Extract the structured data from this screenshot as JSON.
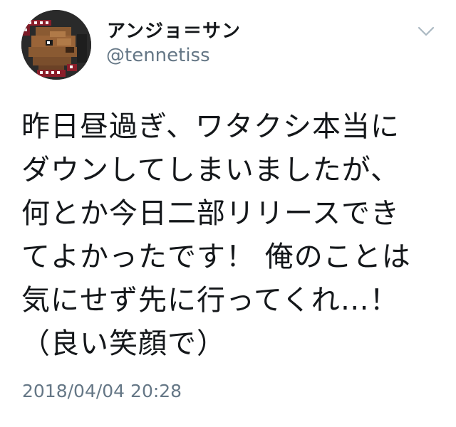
{
  "tweet": {
    "display_name": "アンジョ＝サン",
    "handle": "@tennetiss",
    "text": "昨日昼過ぎ、ワタクシ本当に\nダウンしてしまいましたが、\n何とか今日二部リリースでき\nてよかったです！ 俺のことは\n気にせず先に行ってくれ…！\n（良い笑顔で）",
    "timestamp": "2018/04/04 20:28",
    "menu_icon": "chevron-down-icon",
    "avatar_icon": "pixel-art-avatar"
  },
  "colors": {
    "text_primary": "#14171a",
    "text_secondary": "#657786",
    "chevron": "#aab8c2",
    "background": "#ffffff"
  }
}
